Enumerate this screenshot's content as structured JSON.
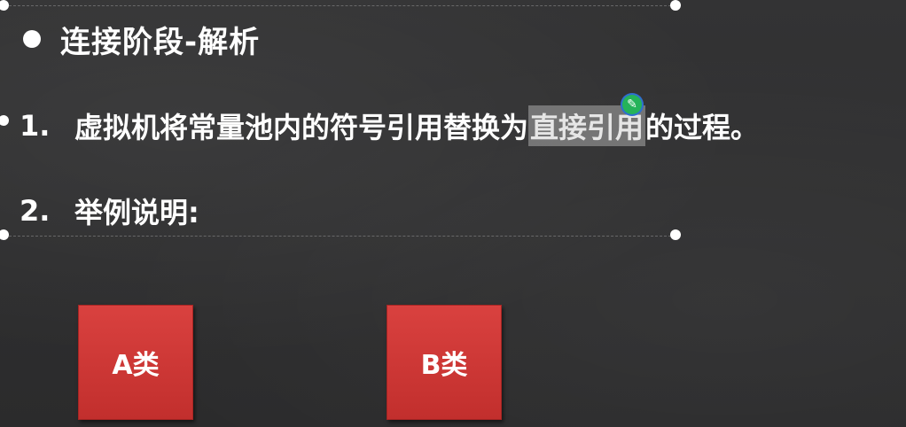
{
  "slide": {
    "title": "连接阶段-解析",
    "items": [
      {
        "number": "1.",
        "text_before": "虚拟机将常量池内的符号引用替换为",
        "highlighted": "直接引用",
        "text_after": "的过程。"
      },
      {
        "number": "2.",
        "text": "举例说明:"
      }
    ],
    "cursor_icon": "green-pen-cursor-icon",
    "cursor_glyph": "✎"
  },
  "diagram": {
    "boxes": [
      {
        "label": "A类"
      },
      {
        "label": "B类"
      }
    ]
  },
  "colors": {
    "background": "#2f2f30",
    "box_red": "#d9413f",
    "highlight": "#aaaaaa"
  }
}
